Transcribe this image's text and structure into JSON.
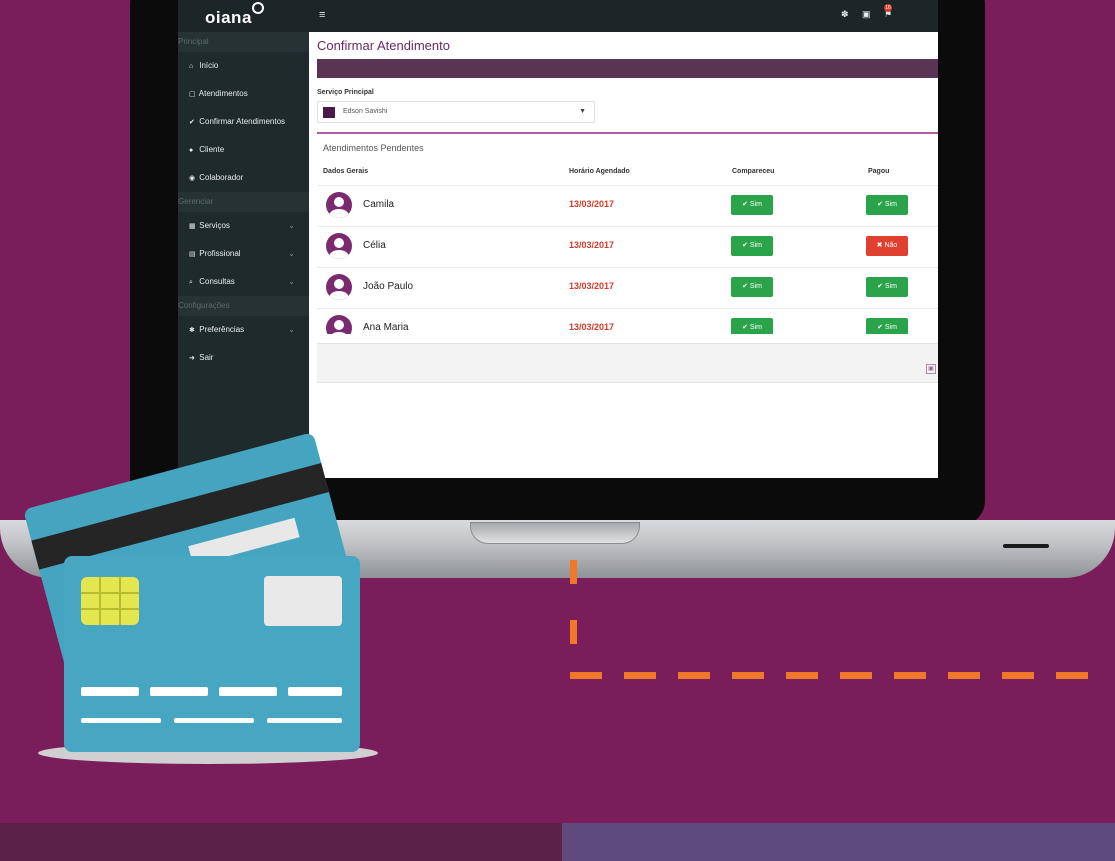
{
  "sidebar": {
    "logo": "oiana",
    "sections": [
      "Principal",
      "Gerenciar",
      "Configurações"
    ],
    "items": [
      {
        "label": "Início",
        "icon": "home-icon"
      },
      {
        "label": "Atendimentos",
        "icon": "calendar-icon"
      },
      {
        "label": "Confirmar Atendimentos",
        "icon": "check-icon"
      },
      {
        "label": "Cliente",
        "icon": "user-icon"
      },
      {
        "label": "Colaborador",
        "icon": "users-icon"
      },
      {
        "label": "Serviços",
        "icon": "grid-icon"
      },
      {
        "label": "Profissional",
        "icon": "briefcase-icon"
      },
      {
        "label": "Consultas",
        "icon": "search-icon"
      },
      {
        "label": "Preferências",
        "icon": "settings-icon"
      },
      {
        "label": "Sair",
        "icon": "logout-icon"
      }
    ]
  },
  "topbar": {
    "notification_count": "16",
    "icons": [
      "menu-icon",
      "paw-icon",
      "calendar-icon",
      "flag-icon"
    ]
  },
  "page": {
    "title": "Confirmar Atendimento",
    "servico_label": "Serviço Principal",
    "servico_value": "Edson Savishi",
    "section_title": "Atendimentos Pendentes",
    "columns": [
      "Dados Gerais",
      "Horário Agendado",
      "Compareceu",
      "Pagou"
    ],
    "rows": [
      {
        "name": "Camila",
        "date": "13/03/2017",
        "compareceu": "✔ Sim",
        "pagou": "✔ Sim",
        "pagou_status": "sim"
      },
      {
        "name": "Célia",
        "date": "13/03/2017",
        "compareceu": "✔ Sim",
        "pagou": "✖ Não",
        "pagou_status": "nao"
      },
      {
        "name": "João Paulo",
        "date": "13/03/2017",
        "compareceu": "✔ Sim",
        "pagou": "✔ Sim",
        "pagou_status": "sim"
      },
      {
        "name": "Ana Maria",
        "date": "13/03/2017",
        "compareceu": "✔ Sim",
        "pagou": "✔ Sim",
        "pagou_status": "sim"
      }
    ]
  },
  "colors": {
    "background": "#7a1d5b",
    "brand_purple": "#5a3553",
    "sidebar": "#1f2a2c",
    "success": "#2aa34a",
    "danger": "#e0402f",
    "date_red": "#d43b2a",
    "card_blue": "#47a6c1",
    "accent_orange": "#f0782b"
  }
}
